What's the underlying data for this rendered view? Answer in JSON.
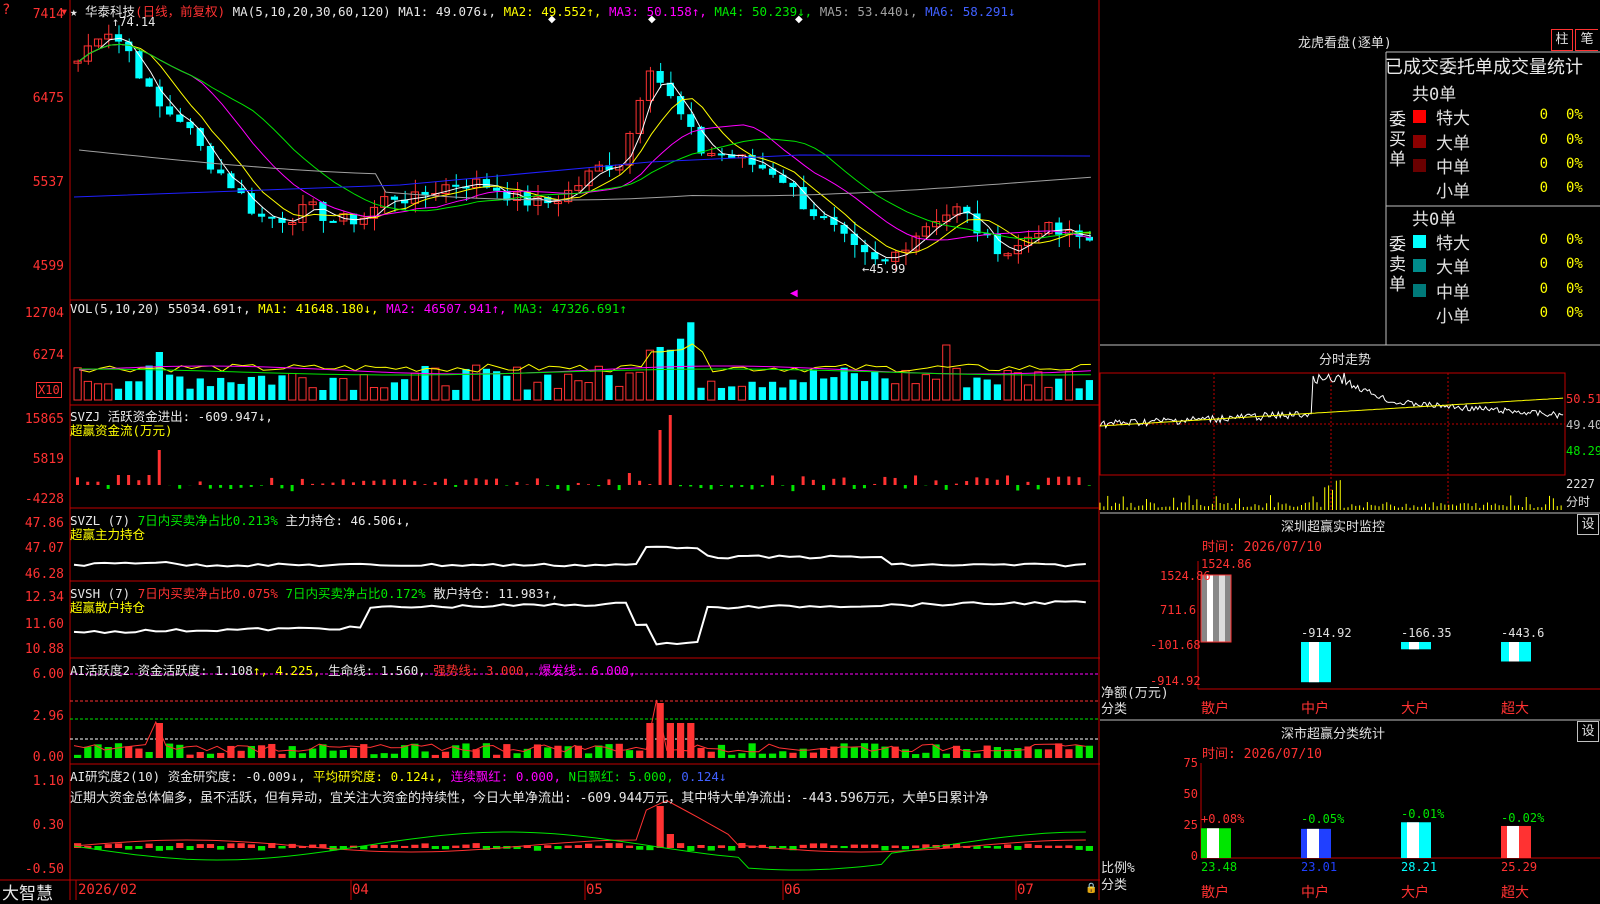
{
  "colors": {
    "up": "#ff3232",
    "down": "#00ffff",
    "grid": "#8b0000",
    "border": "#c00000",
    "ma1": "#ffffff",
    "ma2": "#ffff00",
    "ma3": "#ff00ff",
    "ma4": "#00e600",
    "ma5": "#a0a0a0",
    "ma6": "#2020ff",
    "positive": "#ff3232",
    "negative": "#00e600"
  },
  "icons": {
    "menu": "menu-icon",
    "lock": "lock-icon",
    "star": "★"
  },
  "app": {
    "brand": "大智慧",
    "corner_marker": "?"
  },
  "kline": {
    "title_prefix": "★ 华泰科技",
    "period": "(日线，前复权)",
    "ma_label": "MA(5,10,20,30,60,120)",
    "ma1": "MA1: 49.076↓,",
    "ma2": "MA2: 49.552↑,",
    "ma3": "MA3: 50.158↑,",
    "ma4": "MA4: 50.239↓,",
    "ma5": "MA5: 53.440↓,",
    "ma6": "MA6: 58.291↓",
    "high_label": "74.14",
    "low_label": "45.99",
    "y_labels": [
      "7414",
      "6475",
      "5537",
      "4599"
    ]
  },
  "vol": {
    "title": "VOL(5,10,20)",
    "value": "55034.691↑,",
    "ma1": "MA1: 41648.180↓,",
    "ma2": "MA2: 46507.941↑,",
    "ma3": "MA3: 47326.691↑",
    "y_labels": [
      "12704",
      "6274"
    ],
    "unit": "X10"
  },
  "svzj": {
    "title": "SVZJ  活跃资金进出: -609.947↓,",
    "subtitle": "超赢资金流(万元)",
    "y_labels": [
      "15865",
      "5819",
      "-4228"
    ]
  },
  "svzl": {
    "title": "SVZL (7)",
    "part1": "7日内买卖净占比0.213%",
    "part2": "主力持仓: 46.506↓,",
    "subtitle": "超赢主力持仓",
    "y_labels": [
      "47.86",
      "47.07",
      "46.28"
    ]
  },
  "svsh": {
    "title": "SVSH (7)",
    "part1": "7日内买卖净占比0.075%",
    "part2": "7日内买卖净占比0.172%",
    "part3": "散户持仓: 11.983↑,",
    "subtitle": "超赢散户持仓",
    "y_labels": [
      "12.34",
      "11.60",
      "10.88"
    ]
  },
  "ai_act": {
    "title": "AI活跃度2 资金活跃度: 1.108",
    "p1": "↑, 4.225,",
    "p2": "生命线: 1.560,",
    "p3": "强势线: 3.000,",
    "p4": "爆发线: 6.000,",
    "y_labels": [
      "6.00",
      "2.96",
      "0.00"
    ]
  },
  "ai_res": {
    "title": "AI研究度2(10)",
    "p1": "资金研究度: -0.009↓,",
    "p2": "平均研究度: 0.124↓,",
    "p3": "连续飘红: 0.000,",
    "p4": "N日飘红: 5.000,",
    "p5": "0.124↓",
    "comment": "近期大资金总体偏多，虽不活跃，但有异动，宜关注大资金的持续性，今日大单净流出: -609.944万元，其中特大单净流出: -443.596万元，大单5日累计净",
    "y_labels": [
      "1.10",
      "0.30",
      "-0.50"
    ]
  },
  "date_axis": [
    "2026/02",
    "04",
    "05",
    "06",
    "07"
  ],
  "dragon": {
    "title": "龙虎看盘(逐单)",
    "btn1": "柱",
    "btn2": "笔",
    "header": "已成交委托单成交量统计",
    "buy": {
      "side": "委买单",
      "total": "共0单",
      "rows": [
        {
          "label": "特大",
          "count": "0",
          "pct": "0%"
        },
        {
          "label": "大单",
          "count": "0",
          "pct": "0%"
        },
        {
          "label": "中单",
          "count": "0",
          "pct": "0%"
        },
        {
          "label": "小单",
          "count": "0",
          "pct": "0%"
        }
      ]
    },
    "sell": {
      "side": "委卖单",
      "total": "共0单",
      "rows": [
        {
          "label": "特大",
          "count": "0",
          "pct": "0%"
        },
        {
          "label": "大单",
          "count": "0",
          "pct": "0%"
        },
        {
          "label": "中单",
          "count": "0",
          "pct": "0%"
        },
        {
          "label": "小单",
          "count": "0",
          "pct": "0%"
        }
      ]
    }
  },
  "intraday": {
    "title": "分时走势",
    "price_labels": [
      "50.51",
      "49.40",
      "48.29"
    ],
    "vol_label": "2227",
    "vol_unit": "分时"
  },
  "sz_monitor": {
    "title": "深圳超赢实时监控",
    "btn": "设",
    "time": "时间: 2026/07/10",
    "top_value": "1524.86",
    "y_labels": [
      "1524.86",
      "711.6",
      "-101.68",
      "-914.92"
    ],
    "ylabel": "净额(万元)",
    "xlabel": "分类",
    "bars": [
      {
        "cat": "散户",
        "value": 1524.86,
        "label": "1524.86"
      },
      {
        "cat": "中户",
        "value": -914.92,
        "label": "-914.92"
      },
      {
        "cat": "大户",
        "value": -166.35,
        "label": "-166.35"
      },
      {
        "cat": "超大",
        "value": -443.6,
        "label": "-443.6"
      }
    ]
  },
  "sz_class": {
    "title": "深市超赢分类统计",
    "btn": "设",
    "time": "时间: 2026/07/10",
    "y_labels": [
      "75",
      "50",
      "25",
      "0"
    ],
    "ylabel": "比例%",
    "xlabel": "分类",
    "bars": [
      {
        "cat": "散户",
        "value": 23.48,
        "label": "23.48",
        "change": "+0.08%"
      },
      {
        "cat": "中户",
        "value": 23.01,
        "label": "23.01",
        "change": "-0.05%"
      },
      {
        "cat": "大户",
        "value": 28.21,
        "label": "28.21",
        "change": "-0.01%"
      },
      {
        "cat": "超大",
        "value": 25.29,
        "label": "25.29",
        "change": "-0.02%"
      }
    ]
  }
}
